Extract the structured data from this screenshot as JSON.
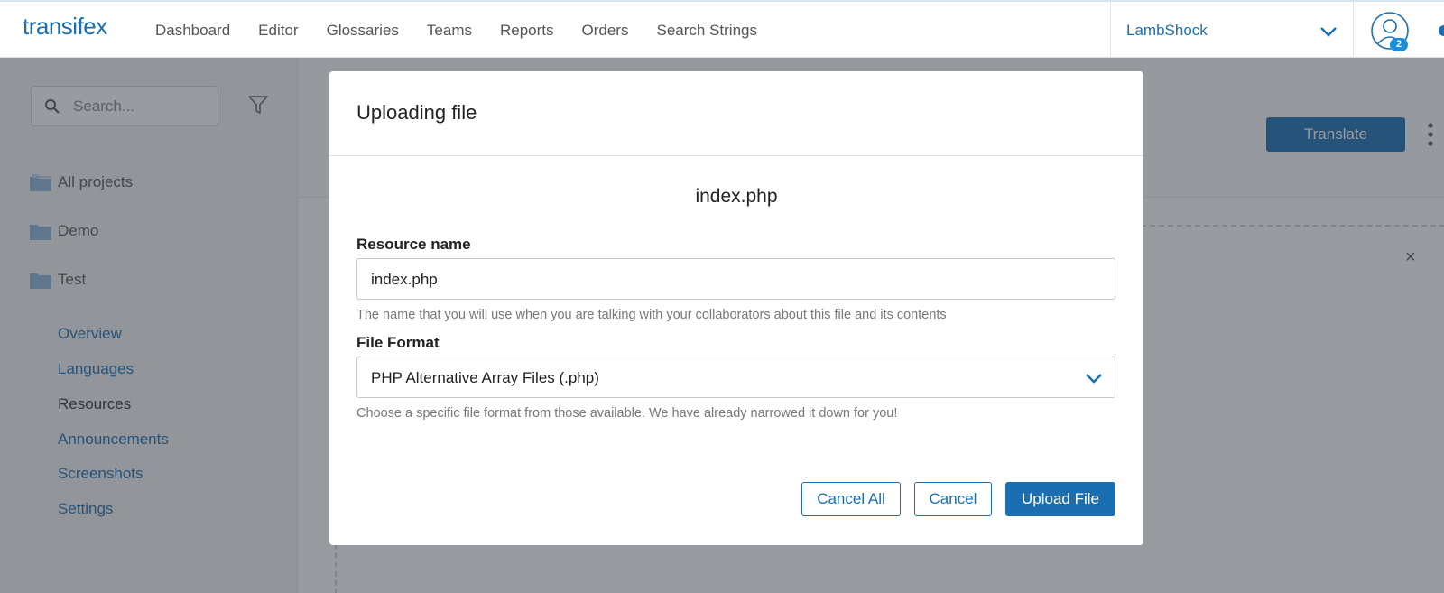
{
  "nav": {
    "logo": "transifex",
    "links": [
      "Dashboard",
      "Editor",
      "Glossaries",
      "Teams",
      "Reports",
      "Orders",
      "Search Strings"
    ],
    "org_name": "LambShock",
    "notification_count": "2"
  },
  "sidebar": {
    "search_placeholder": "Search...",
    "projects": [
      "All projects",
      "Demo",
      "Test"
    ],
    "subitems": [
      {
        "label": "Overview",
        "active": false
      },
      {
        "label": "Languages",
        "active": false
      },
      {
        "label": "Resources",
        "active": true
      },
      {
        "label": "Announcements",
        "active": false
      },
      {
        "label": "Screenshots",
        "active": false
      },
      {
        "label": "Settings",
        "active": false
      }
    ]
  },
  "main": {
    "translate_label": "Translate",
    "close_symbol": "×"
  },
  "modal": {
    "title": "Uploading file",
    "file_name": "index.php",
    "resource_name_label": "Resource name",
    "resource_name_value": "index.php",
    "resource_name_hint": "The name that you will use when you are talking with your collaborators about this file and its contents",
    "file_format_label": "File Format",
    "file_format_value": "PHP Alternative Array Files (.php)",
    "file_format_hint": "Choose a specific file format from those available. We have already narrowed it down for you!",
    "cancel_all_label": "Cancel All",
    "cancel_label": "Cancel",
    "upload_label": "Upload File"
  },
  "colors": {
    "brand": "#1b6fb0",
    "overlay": "#323741"
  }
}
